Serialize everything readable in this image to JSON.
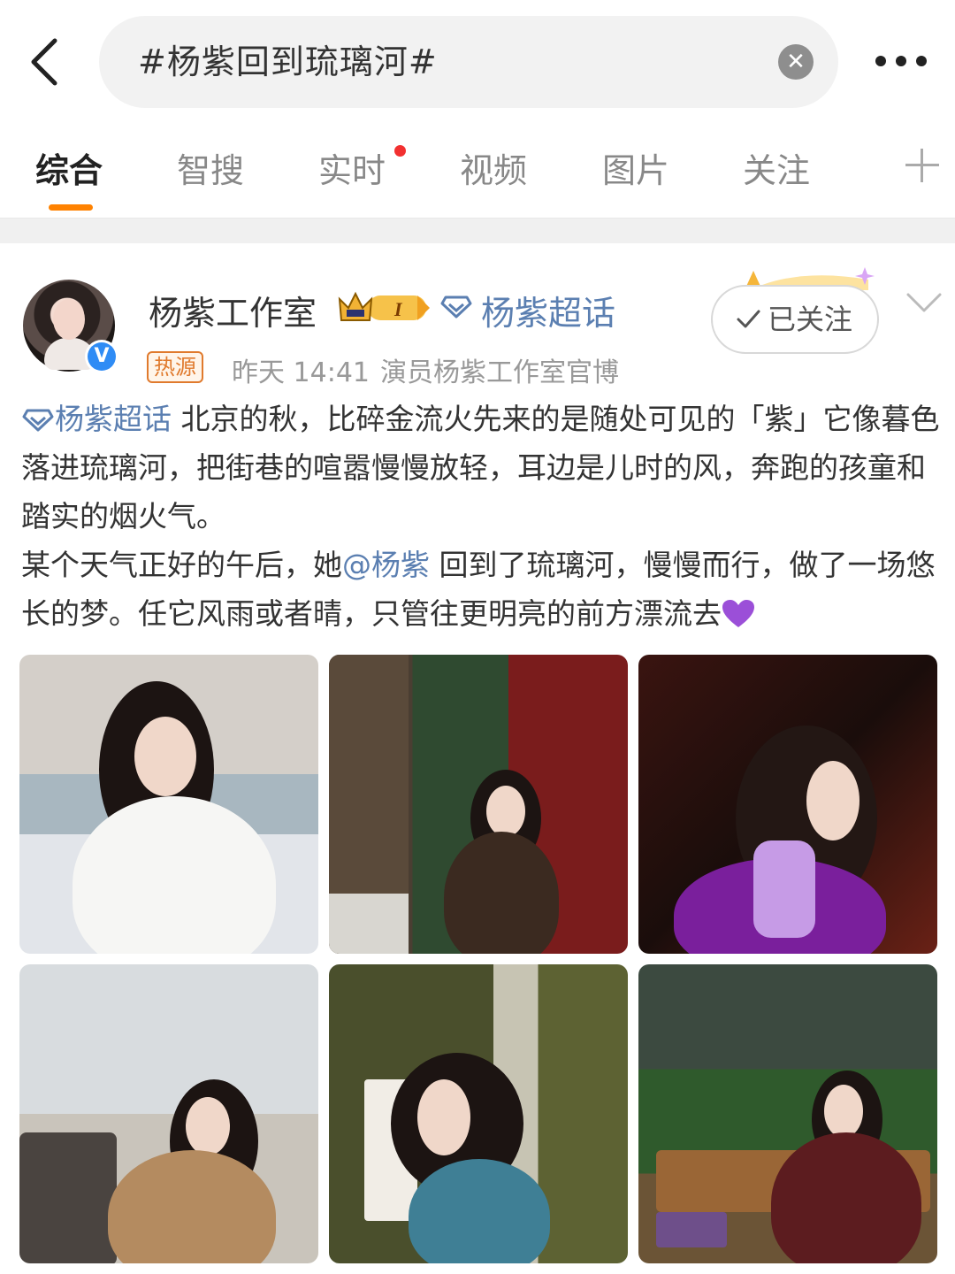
{
  "search": {
    "query": "#杨紫回到琉璃河#"
  },
  "tabs": [
    {
      "label": "综合",
      "active": true
    },
    {
      "label": "智搜"
    },
    {
      "label": "实时",
      "badge": true
    },
    {
      "label": "视频"
    },
    {
      "label": "图片"
    },
    {
      "label": "关注"
    }
  ],
  "post": {
    "author": "杨紫工作室",
    "supertopic": "杨紫超话",
    "hot_badge": "热源",
    "time": "昨天 14:41",
    "source": "演员杨紫工作室官博",
    "follow_label": "已关注",
    "text": {
      "topic_link": "杨紫超话",
      "part1": " 北京的秋，比碎金流火先来的是随处可见的「紫」它像暮色落进琉璃河，把街巷的喧嚣慢慢放轻，耳边是儿时的风，奔跑的孩童和踏实的烟火气。",
      "part2": "某个天气正好的午后，她",
      "mention": "@杨紫",
      "part3": " 回到了琉璃河，慢慢而行，做了一场悠长的梦。任它风雨或者晴，只管往更明亮的前方漂流去"
    },
    "images": [
      "photo-1",
      "photo-2",
      "photo-3",
      "photo-4",
      "photo-5",
      "photo-6"
    ]
  },
  "colors": {
    "accent": "#ff8200",
    "link": "#5b7fb1",
    "badge_dot": "#f23030",
    "verified": "#2f8cf5"
  },
  "icons": [
    "back-arrow-icon",
    "clear-icon",
    "more-icon",
    "plus-icon",
    "crown-icon",
    "diamond-icon",
    "check-icon",
    "chevron-down-icon",
    "purple-heart-icon"
  ]
}
